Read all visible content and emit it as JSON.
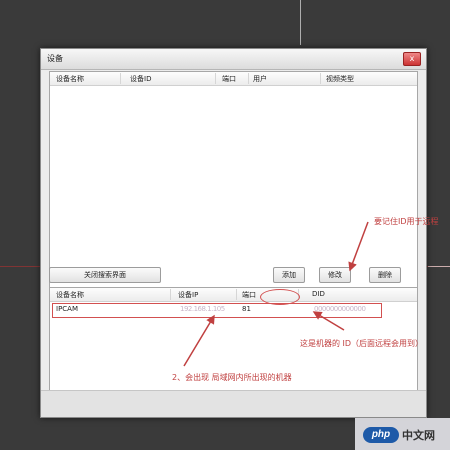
{
  "window": {
    "title": "设备",
    "close_label": "x"
  },
  "device_list": {
    "columns": [
      "设备名称",
      "设备ID",
      "端口",
      "用户",
      "视频类型"
    ]
  },
  "buttons": {
    "close_search": "关闭搜索界面",
    "add": "添加",
    "modify": "修改",
    "delete": "删除"
  },
  "search_results": {
    "columns": [
      "设备名称",
      "设备IP",
      "端口",
      "DID"
    ],
    "rows": [
      {
        "name": "IPCAM",
        "ip": "192.168.1.105",
        "port": "81",
        "did": "0000000000000"
      }
    ]
  },
  "annotations": {
    "remember_id": "要记住ID用于远程",
    "machine_id": "这是机器的 ID（后面远程会用到）",
    "lan_devices": "2、会出现 局域网内所出现的机器"
  },
  "watermark": {
    "logo": "php",
    "text": "中文网"
  },
  "colors": {
    "annotation": "#c04040",
    "accent": "#1e5aa8"
  }
}
